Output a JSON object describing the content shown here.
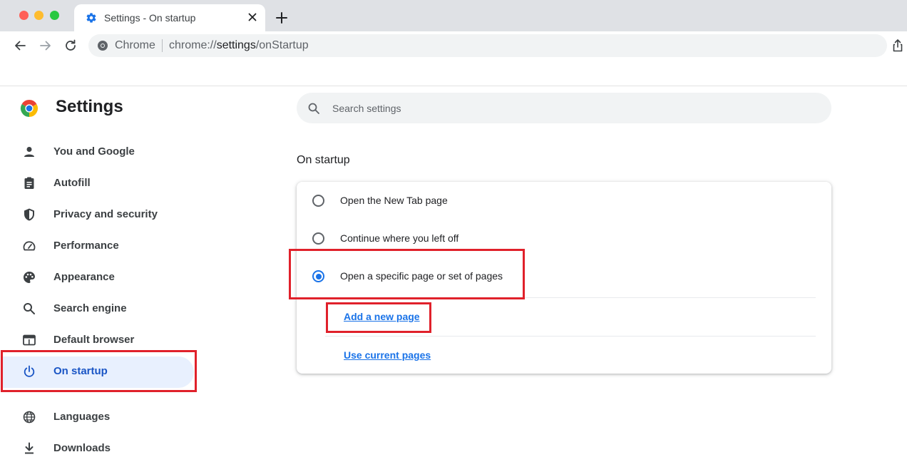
{
  "browser": {
    "tab_title": "Settings - On startup",
    "omnibox": {
      "site_label": "Chrome",
      "url_prefix": "chrome://",
      "url_host": "settings",
      "url_path": "/onStartup"
    }
  },
  "settings": {
    "title": "Settings",
    "search_placeholder": "Search settings",
    "sidebar": [
      {
        "id": "you-and-google",
        "label": "You and Google",
        "icon": "person-icon"
      },
      {
        "id": "autofill",
        "label": "Autofill",
        "icon": "clipboard-icon"
      },
      {
        "id": "privacy",
        "label": "Privacy and security",
        "icon": "shield-icon"
      },
      {
        "id": "performance",
        "label": "Performance",
        "icon": "speedometer-icon"
      },
      {
        "id": "appearance",
        "label": "Appearance",
        "icon": "palette-icon"
      },
      {
        "id": "search-engine",
        "label": "Search engine",
        "icon": "search-icon"
      },
      {
        "id": "default-browser",
        "label": "Default browser",
        "icon": "browser-window-icon"
      },
      {
        "id": "on-startup",
        "label": "On startup",
        "icon": "power-icon",
        "active": true
      },
      {
        "id": "languages",
        "label": "Languages",
        "icon": "globe-icon"
      },
      {
        "id": "downloads",
        "label": "Downloads",
        "icon": "download-icon"
      }
    ],
    "section_title": "On startup",
    "options": [
      {
        "label": "Open the New Tab page",
        "checked": false
      },
      {
        "label": "Continue where you left off",
        "checked": false
      },
      {
        "label": "Open a specific page or set of pages",
        "checked": true
      }
    ],
    "links": {
      "add_page": "Add a new page",
      "use_current": "Use current pages"
    }
  },
  "colors": {
    "accent": "#1a73e8",
    "active_nav_bg": "#e8f0fe",
    "highlight_box": "#e0212b"
  }
}
